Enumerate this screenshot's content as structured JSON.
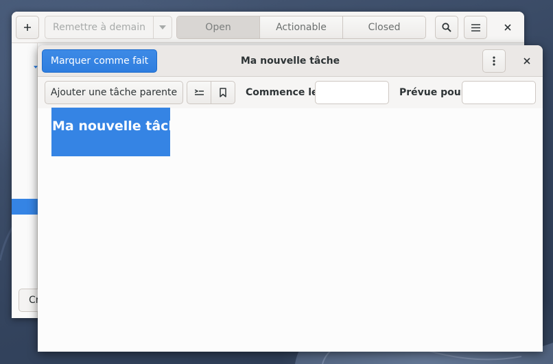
{
  "back_window": {
    "add_icon": "plus-icon",
    "postpone_label": "Remettre à demain",
    "postpone_dropdown_icon": "chevron-down-icon",
    "tabs": [
      {
        "label": "Open",
        "active": true
      },
      {
        "label": "Actionable",
        "active": false
      },
      {
        "label": "Closed",
        "active": false
      }
    ],
    "search_icon": "search-icon",
    "menu_icon": "hamburger-menu-icon",
    "close_icon": "close-icon",
    "bottom_button_label": "Cr"
  },
  "dialog": {
    "mark_done_label": "Marquer comme fait",
    "title": "Ma nouvelle tâche",
    "more_icon": "vertical-dots-icon",
    "close_icon": "close-icon",
    "add_parent_label": "Ajouter une tâche parente",
    "subtasks_icon": "insert-subtask-icon",
    "tag_icon": "bookmark-icon",
    "start_label": "Commence le",
    "start_value": "",
    "due_label": "Prévue pour",
    "due_value": "",
    "task_text": "Ma nouvelle tâche"
  },
  "colors": {
    "accent": "#3584e4",
    "header_bg": "#ebe8e6",
    "toolbar_bg": "#f6f5f4"
  }
}
